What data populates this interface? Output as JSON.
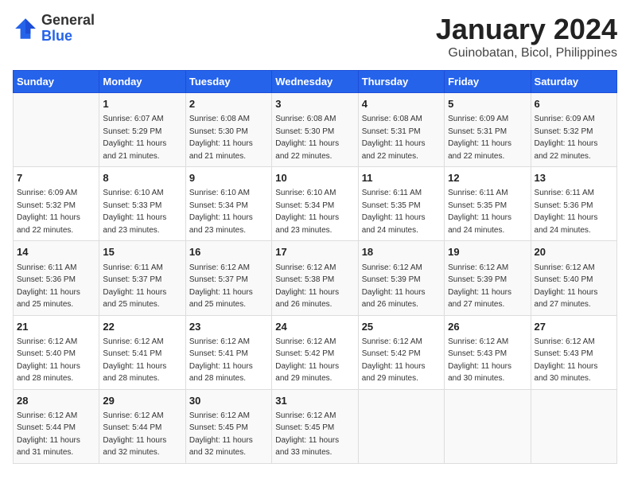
{
  "header": {
    "logo_general": "General",
    "logo_blue": "Blue",
    "title": "January 2024",
    "subtitle": "Guinobatan, Bicol, Philippines"
  },
  "columns": [
    "Sunday",
    "Monday",
    "Tuesday",
    "Wednesday",
    "Thursday",
    "Friday",
    "Saturday"
  ],
  "weeks": [
    [
      {
        "date": "",
        "info": ""
      },
      {
        "date": "1",
        "info": "Sunrise: 6:07 AM\nSunset: 5:29 PM\nDaylight: 11 hours\nand 21 minutes."
      },
      {
        "date": "2",
        "info": "Sunrise: 6:08 AM\nSunset: 5:30 PM\nDaylight: 11 hours\nand 21 minutes."
      },
      {
        "date": "3",
        "info": "Sunrise: 6:08 AM\nSunset: 5:30 PM\nDaylight: 11 hours\nand 22 minutes."
      },
      {
        "date": "4",
        "info": "Sunrise: 6:08 AM\nSunset: 5:31 PM\nDaylight: 11 hours\nand 22 minutes."
      },
      {
        "date": "5",
        "info": "Sunrise: 6:09 AM\nSunset: 5:31 PM\nDaylight: 11 hours\nand 22 minutes."
      },
      {
        "date": "6",
        "info": "Sunrise: 6:09 AM\nSunset: 5:32 PM\nDaylight: 11 hours\nand 22 minutes."
      }
    ],
    [
      {
        "date": "7",
        "info": "Sunrise: 6:09 AM\nSunset: 5:32 PM\nDaylight: 11 hours\nand 22 minutes."
      },
      {
        "date": "8",
        "info": "Sunrise: 6:10 AM\nSunset: 5:33 PM\nDaylight: 11 hours\nand 23 minutes."
      },
      {
        "date": "9",
        "info": "Sunrise: 6:10 AM\nSunset: 5:34 PM\nDaylight: 11 hours\nand 23 minutes."
      },
      {
        "date": "10",
        "info": "Sunrise: 6:10 AM\nSunset: 5:34 PM\nDaylight: 11 hours\nand 23 minutes."
      },
      {
        "date": "11",
        "info": "Sunrise: 6:11 AM\nSunset: 5:35 PM\nDaylight: 11 hours\nand 24 minutes."
      },
      {
        "date": "12",
        "info": "Sunrise: 6:11 AM\nSunset: 5:35 PM\nDaylight: 11 hours\nand 24 minutes."
      },
      {
        "date": "13",
        "info": "Sunrise: 6:11 AM\nSunset: 5:36 PM\nDaylight: 11 hours\nand 24 minutes."
      }
    ],
    [
      {
        "date": "14",
        "info": "Sunrise: 6:11 AM\nSunset: 5:36 PM\nDaylight: 11 hours\nand 25 minutes."
      },
      {
        "date": "15",
        "info": "Sunrise: 6:11 AM\nSunset: 5:37 PM\nDaylight: 11 hours\nand 25 minutes."
      },
      {
        "date": "16",
        "info": "Sunrise: 6:12 AM\nSunset: 5:37 PM\nDaylight: 11 hours\nand 25 minutes."
      },
      {
        "date": "17",
        "info": "Sunrise: 6:12 AM\nSunset: 5:38 PM\nDaylight: 11 hours\nand 26 minutes."
      },
      {
        "date": "18",
        "info": "Sunrise: 6:12 AM\nSunset: 5:39 PM\nDaylight: 11 hours\nand 26 minutes."
      },
      {
        "date": "19",
        "info": "Sunrise: 6:12 AM\nSunset: 5:39 PM\nDaylight: 11 hours\nand 27 minutes."
      },
      {
        "date": "20",
        "info": "Sunrise: 6:12 AM\nSunset: 5:40 PM\nDaylight: 11 hours\nand 27 minutes."
      }
    ],
    [
      {
        "date": "21",
        "info": "Sunrise: 6:12 AM\nSunset: 5:40 PM\nDaylight: 11 hours\nand 28 minutes."
      },
      {
        "date": "22",
        "info": "Sunrise: 6:12 AM\nSunset: 5:41 PM\nDaylight: 11 hours\nand 28 minutes."
      },
      {
        "date": "23",
        "info": "Sunrise: 6:12 AM\nSunset: 5:41 PM\nDaylight: 11 hours\nand 28 minutes."
      },
      {
        "date": "24",
        "info": "Sunrise: 6:12 AM\nSunset: 5:42 PM\nDaylight: 11 hours\nand 29 minutes."
      },
      {
        "date": "25",
        "info": "Sunrise: 6:12 AM\nSunset: 5:42 PM\nDaylight: 11 hours\nand 29 minutes."
      },
      {
        "date": "26",
        "info": "Sunrise: 6:12 AM\nSunset: 5:43 PM\nDaylight: 11 hours\nand 30 minutes."
      },
      {
        "date": "27",
        "info": "Sunrise: 6:12 AM\nSunset: 5:43 PM\nDaylight: 11 hours\nand 30 minutes."
      }
    ],
    [
      {
        "date": "28",
        "info": "Sunrise: 6:12 AM\nSunset: 5:44 PM\nDaylight: 11 hours\nand 31 minutes."
      },
      {
        "date": "29",
        "info": "Sunrise: 6:12 AM\nSunset: 5:44 PM\nDaylight: 11 hours\nand 32 minutes."
      },
      {
        "date": "30",
        "info": "Sunrise: 6:12 AM\nSunset: 5:45 PM\nDaylight: 11 hours\nand 32 minutes."
      },
      {
        "date": "31",
        "info": "Sunrise: 6:12 AM\nSunset: 5:45 PM\nDaylight: 11 hours\nand 33 minutes."
      },
      {
        "date": "",
        "info": ""
      },
      {
        "date": "",
        "info": ""
      },
      {
        "date": "",
        "info": ""
      }
    ]
  ]
}
